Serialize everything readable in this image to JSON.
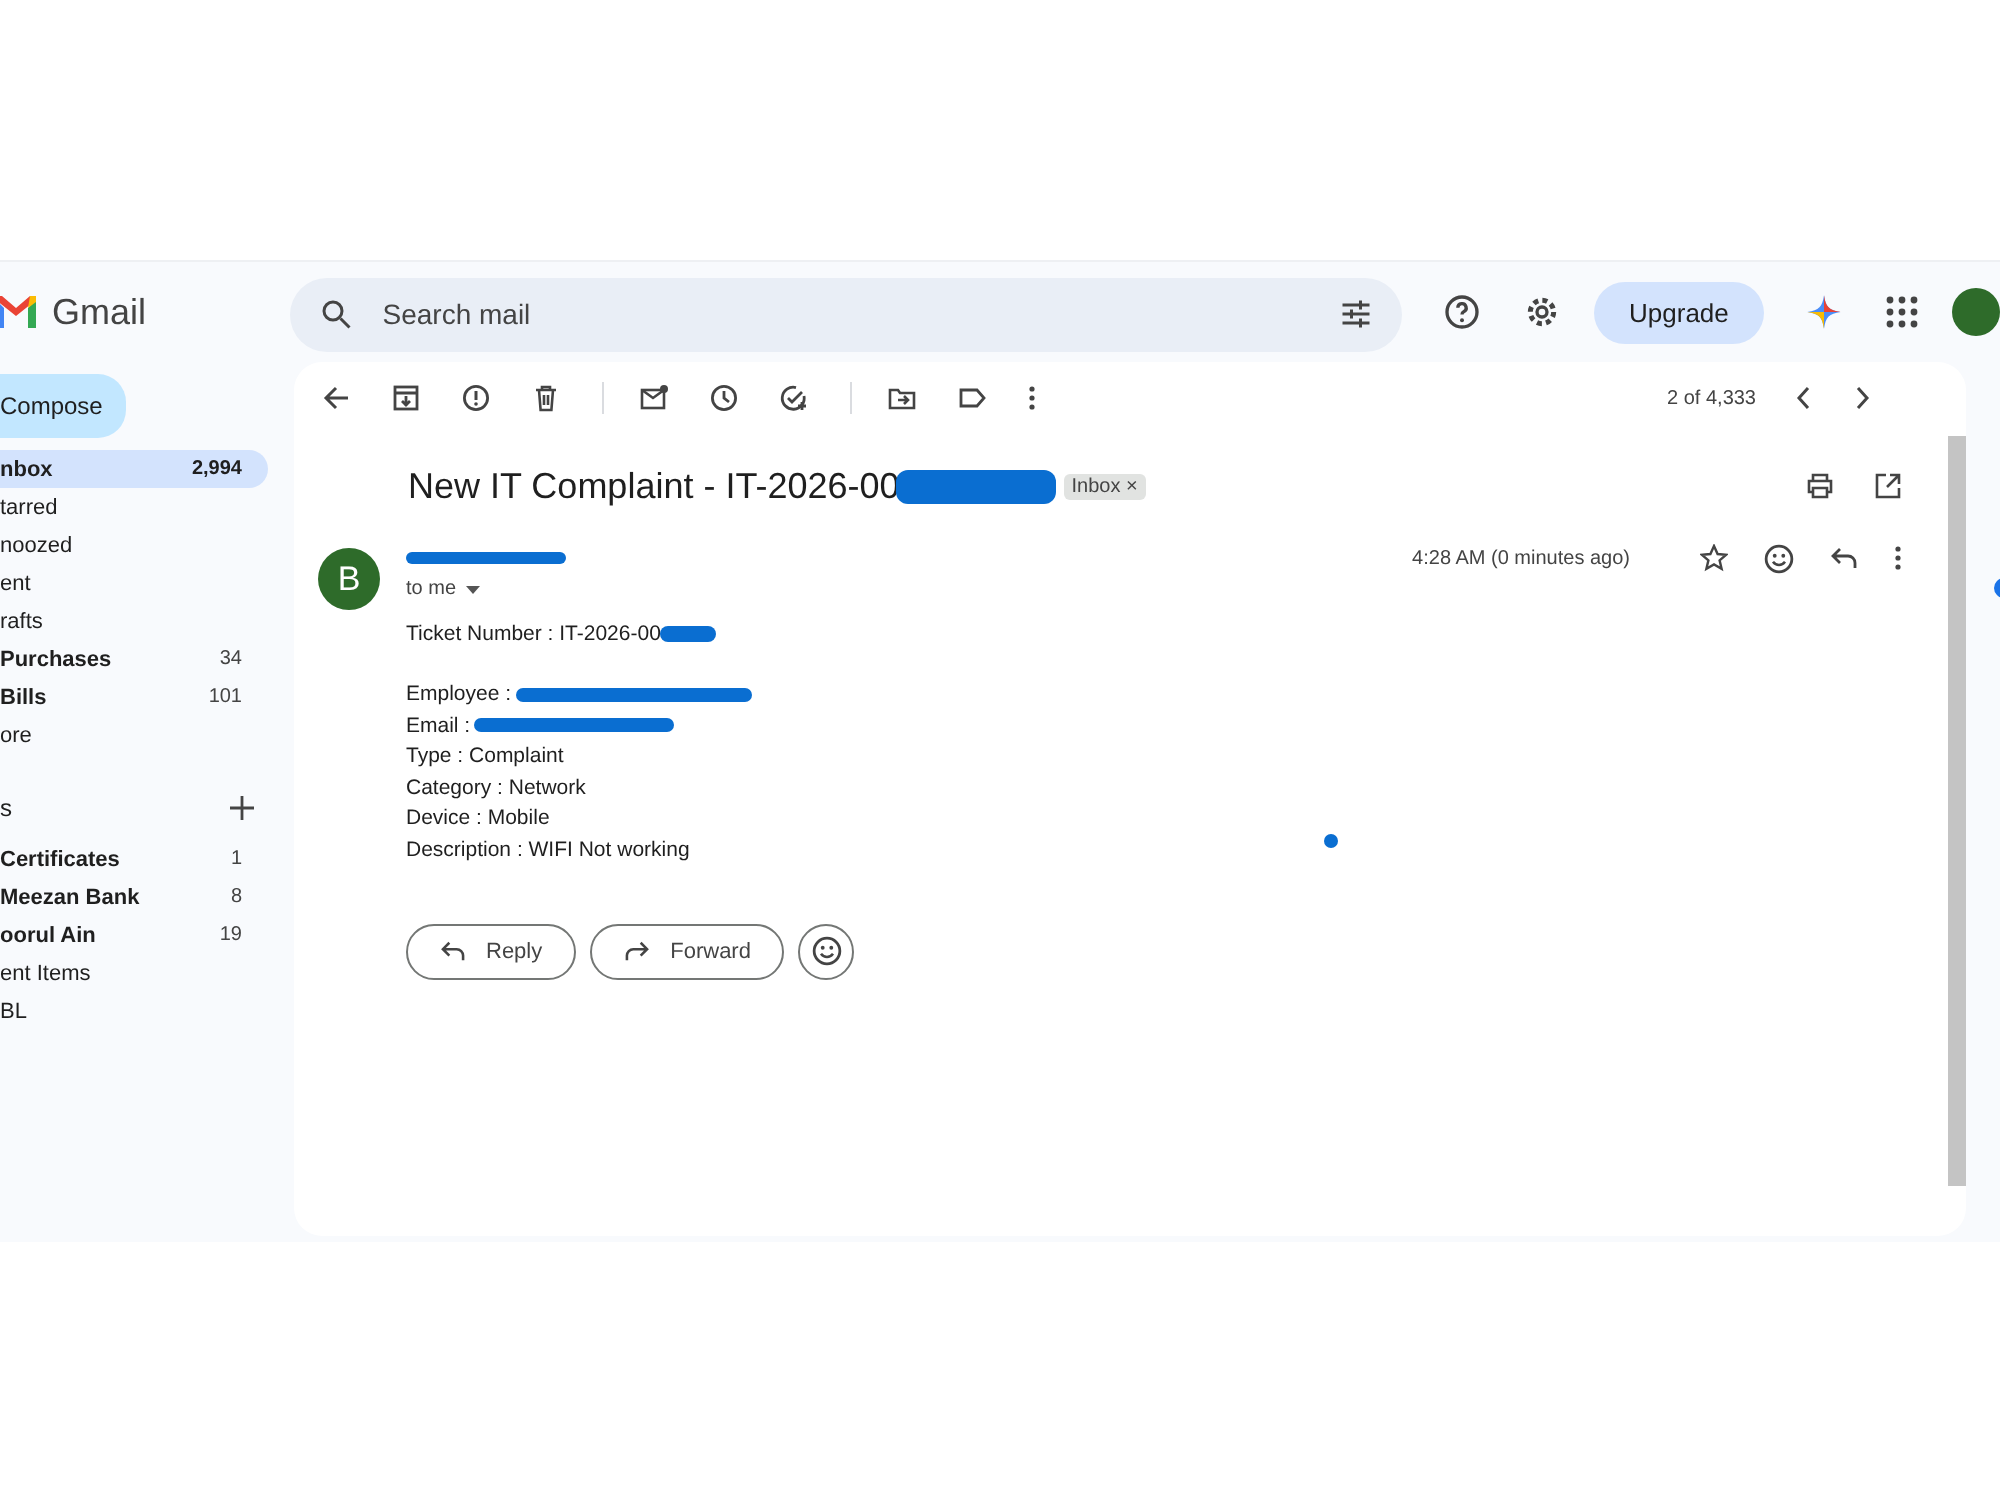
{
  "app": {
    "name": "Gmail"
  },
  "search": {
    "placeholder": "Search mail"
  },
  "upgrade": "Upgrade",
  "compose": "Compose",
  "folders": [
    {
      "label": "nbox",
      "count": "2,994",
      "bold": true,
      "selected": true
    },
    {
      "label": "tarred",
      "bold": false,
      "selected": false
    },
    {
      "label": "noozed",
      "bold": false,
      "selected": false
    },
    {
      "label": "ent",
      "bold": false,
      "selected": false
    },
    {
      "label": "rafts",
      "bold": false,
      "selected": false
    },
    {
      "label": "Purchases",
      "count": "34",
      "bold": true,
      "selected": false
    },
    {
      "label": "Bills",
      "count": "101",
      "bold": true,
      "selected": false
    },
    {
      "label": "ore",
      "bold": false,
      "selected": false
    }
  ],
  "labels_heading": "s",
  "labels": [
    {
      "label": "Certificates",
      "count": "1",
      "bold": true
    },
    {
      "label": "Meezan Bank",
      "count": "8",
      "bold": true
    },
    {
      "label": "oorul Ain",
      "count": "19",
      "bold": true
    },
    {
      "label": "ent Items",
      "bold": false
    },
    {
      "label": "BL",
      "bold": false
    }
  ],
  "pager": "2 of 4,333",
  "email": {
    "subject": "New IT Complaint - IT-2026-00",
    "tag": "Inbox",
    "tag_close": "×",
    "avatar": "B",
    "recipient": "to me",
    "time": "4:28 AM (0 minutes ago)",
    "body": [
      {
        "text": "Ticket Number : IT-2026-00",
        "redacted": true
      },
      {
        "text": "Employee :",
        "redacted": true,
        "gap": true
      },
      {
        "text": "Email :",
        "redacted": true
      },
      {
        "text": "Type : Complaint",
        "redacted": false
      },
      {
        "text": "Category : Network",
        "redacted": false
      },
      {
        "text": "Device : Mobile",
        "redacted": false
      },
      {
        "text": "Description : WIFI Not working",
        "redacted": false
      }
    ]
  },
  "actions": [
    "Reply",
    "Forward"
  ]
}
